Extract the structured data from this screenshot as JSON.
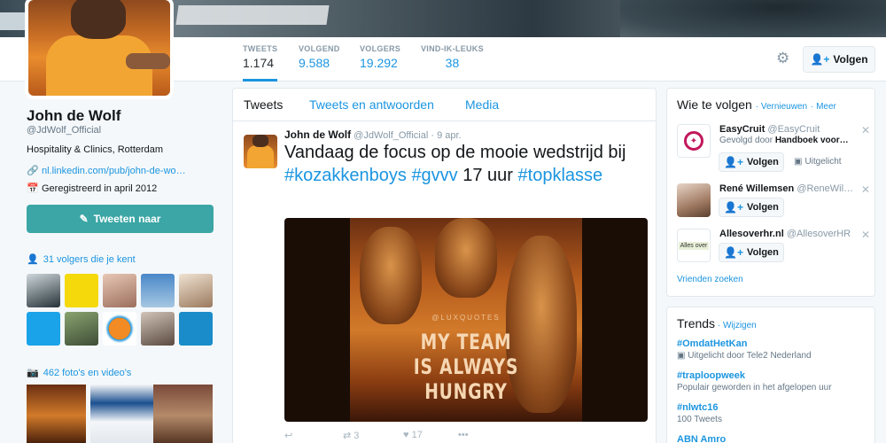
{
  "profile": {
    "name": "John de Wolf",
    "handle": "@JdWolf_Official",
    "bio": "Hospitality & Clinics, Rotterdam",
    "link": "nl.linkedin.com/pub/john-de-wo…",
    "joined": "Geregistreerd in april 2012",
    "tweet_to": "Tweeten naar",
    "followers_you_know": "31 volgers die je kent",
    "photos_videos": "462 foto's en video's"
  },
  "stats": [
    {
      "label": "TWEETS",
      "value": "1.174"
    },
    {
      "label": "VOLGEND",
      "value": "9.588"
    },
    {
      "label": "VOLGERS",
      "value": "19.292"
    },
    {
      "label": "VIND-IK-LEUKS",
      "value": "38"
    }
  ],
  "header": {
    "follow_label": "Volgen"
  },
  "tabs": [
    "Tweets",
    "Tweets en antwoorden",
    "Media"
  ],
  "tweet": {
    "author": "John de Wolf",
    "handle": "@JdWolf_Official",
    "date": "· 9 apr.",
    "text_plain_1": "Vandaag de focus op de mooie wedstrijd bij ",
    "tag1": "#kozakkenboys",
    "tag2": "#gvvv",
    "text_plain_2": " 17 uur ",
    "tag3": "#topklasse",
    "image_small": "@LUXQUOTES",
    "image_caption_1": "MY TEAM",
    "image_caption_2": "IS ALWAYS",
    "image_caption_3": "HUNGRY",
    "retweets": "3",
    "likes": "17"
  },
  "who_to_follow": {
    "title": "Wie te volgen",
    "refresh": "Vernieuwen",
    "more": "Meer",
    "follow_label": "Volgen",
    "find": "Vrienden zoeken",
    "users": [
      {
        "name": "EasyCruit",
        "handle": "@EasyCruit",
        "sub_prefix": "Gevolgd door ",
        "sub_bold": "Handboek voor…",
        "promoted": "Uitgelicht"
      },
      {
        "name": "René Willemsen",
        "handle": "@ReneWil…"
      },
      {
        "name": "Allesoverhr.nl",
        "handle": "@AllesoverHR"
      }
    ]
  },
  "trends": {
    "title": "Trends",
    "change": "Wijzigen",
    "items": [
      {
        "tag": "#OmdatHetKan",
        "desc": "Uitgelicht door Tele2 Nederland"
      },
      {
        "tag": "#traploopweek",
        "desc": "Populair geworden in het afgelopen uur"
      },
      {
        "tag": "#nlwtc16",
        "desc": "100 Tweets"
      },
      {
        "tag": "ABN Amro",
        "desc": ""
      }
    ]
  },
  "colors": {
    "accent": "#1b95e0",
    "tweet_button": "#3ba6a5"
  }
}
